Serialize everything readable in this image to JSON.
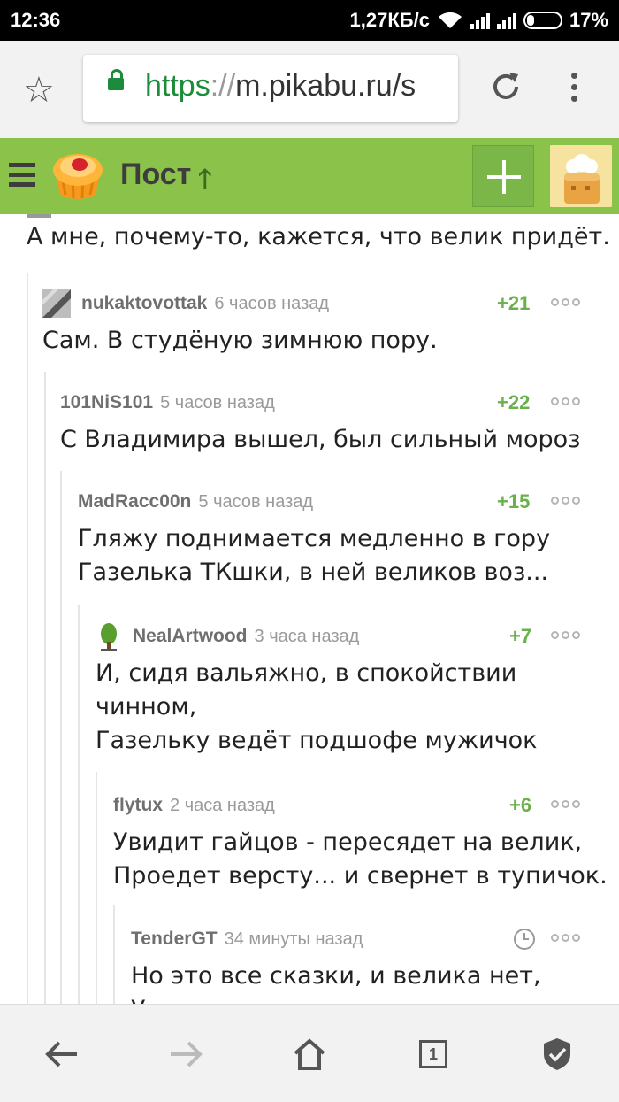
{
  "status_bar": {
    "time": "12:36",
    "net_speed": "1,27КБ/с",
    "battery": "17%"
  },
  "browser": {
    "url_scheme": "https",
    "url_sep": "://",
    "url_host": "m.pikabu.ru/s"
  },
  "header": {
    "title": "Пост"
  },
  "root_comment": {
    "text": "А мне, почему-то, кажется, что велик придёт. :)"
  },
  "comments": [
    {
      "user": "nukaktovottak",
      "time": "6 часов назад",
      "score": "+21",
      "text": "Сам. В студёную зимнюю пору."
    },
    {
      "user": "101NiS101",
      "time": "5 часов назад",
      "score": "+22",
      "text": "С Владимира вышел, был сильный мороз"
    },
    {
      "user": "MadRacc00n",
      "time": "5 часов назад",
      "score": "+15",
      "text": "Гляжу поднимается медленно в гору\nГазелька ТКшки, в ней великов воз..."
    },
    {
      "user": "NealArtwood",
      "time": "3 часа назад",
      "score": "+7",
      "text": "И, сидя вальяжно, в спокойствии\nчинном,\nГазельку ведёт подшофе мужичок"
    },
    {
      "user": "flytux",
      "time": "2 часа назад",
      "score": "+6",
      "text": "Увидит гайцов - пересядет на велик,\nПроедет версту... и свернет в тупичок."
    },
    {
      "user": "TenderGT",
      "time": "34 минуты назад",
      "score": "",
      "text": "Но это все сказки, и велика нет,\nУвы, топикстартер теперь - дохопел"
    }
  ],
  "bottom_nav": {
    "tab_count": "1"
  }
}
